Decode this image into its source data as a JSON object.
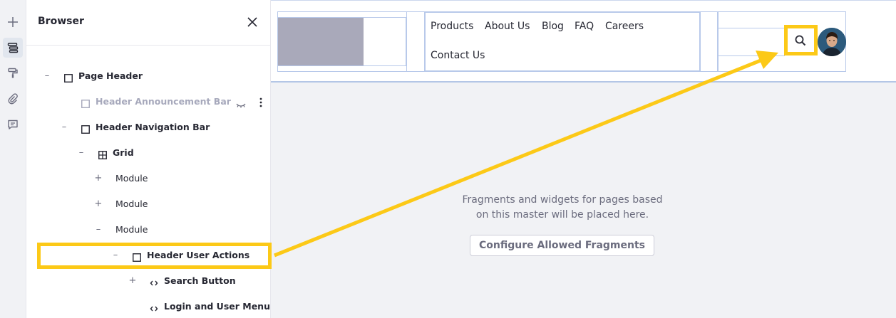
{
  "panel": {
    "title": "Browser"
  },
  "rail": {
    "icons": [
      "plus-icon",
      "layers-icon",
      "paint-roller-icon",
      "paperclip-icon",
      "comment-icon"
    ]
  },
  "tree": [
    {
      "label": "Page Header",
      "toggle": "–"
    },
    {
      "label": "Header Announcement Bar",
      "toggle": ""
    },
    {
      "label": "Header Navigation Bar",
      "toggle": "–"
    },
    {
      "label": "Grid",
      "toggle": "–"
    },
    {
      "label": "Module",
      "toggle": "+"
    },
    {
      "label": "Module",
      "toggle": "+"
    },
    {
      "label": "Module",
      "toggle": "–"
    },
    {
      "label": "Header User Actions",
      "toggle": "–"
    },
    {
      "label": "Search Button",
      "toggle": "+"
    },
    {
      "label": "Login and User Menu",
      "toggle": ""
    }
  ],
  "nav": {
    "links": [
      "Products",
      "About Us",
      "Blog",
      "FAQ",
      "Careers",
      "Contact Us"
    ]
  },
  "canvas": {
    "empty_message_line1": "Fragments and widgets for pages based",
    "empty_message_line2": "on this master will be placed here.",
    "configure_button": "Configure Allowed Fragments"
  },
  "colors": {
    "highlight": "#fcc917",
    "logo_placeholder": "#a9a9ba",
    "outline": "#b8c9ea"
  }
}
